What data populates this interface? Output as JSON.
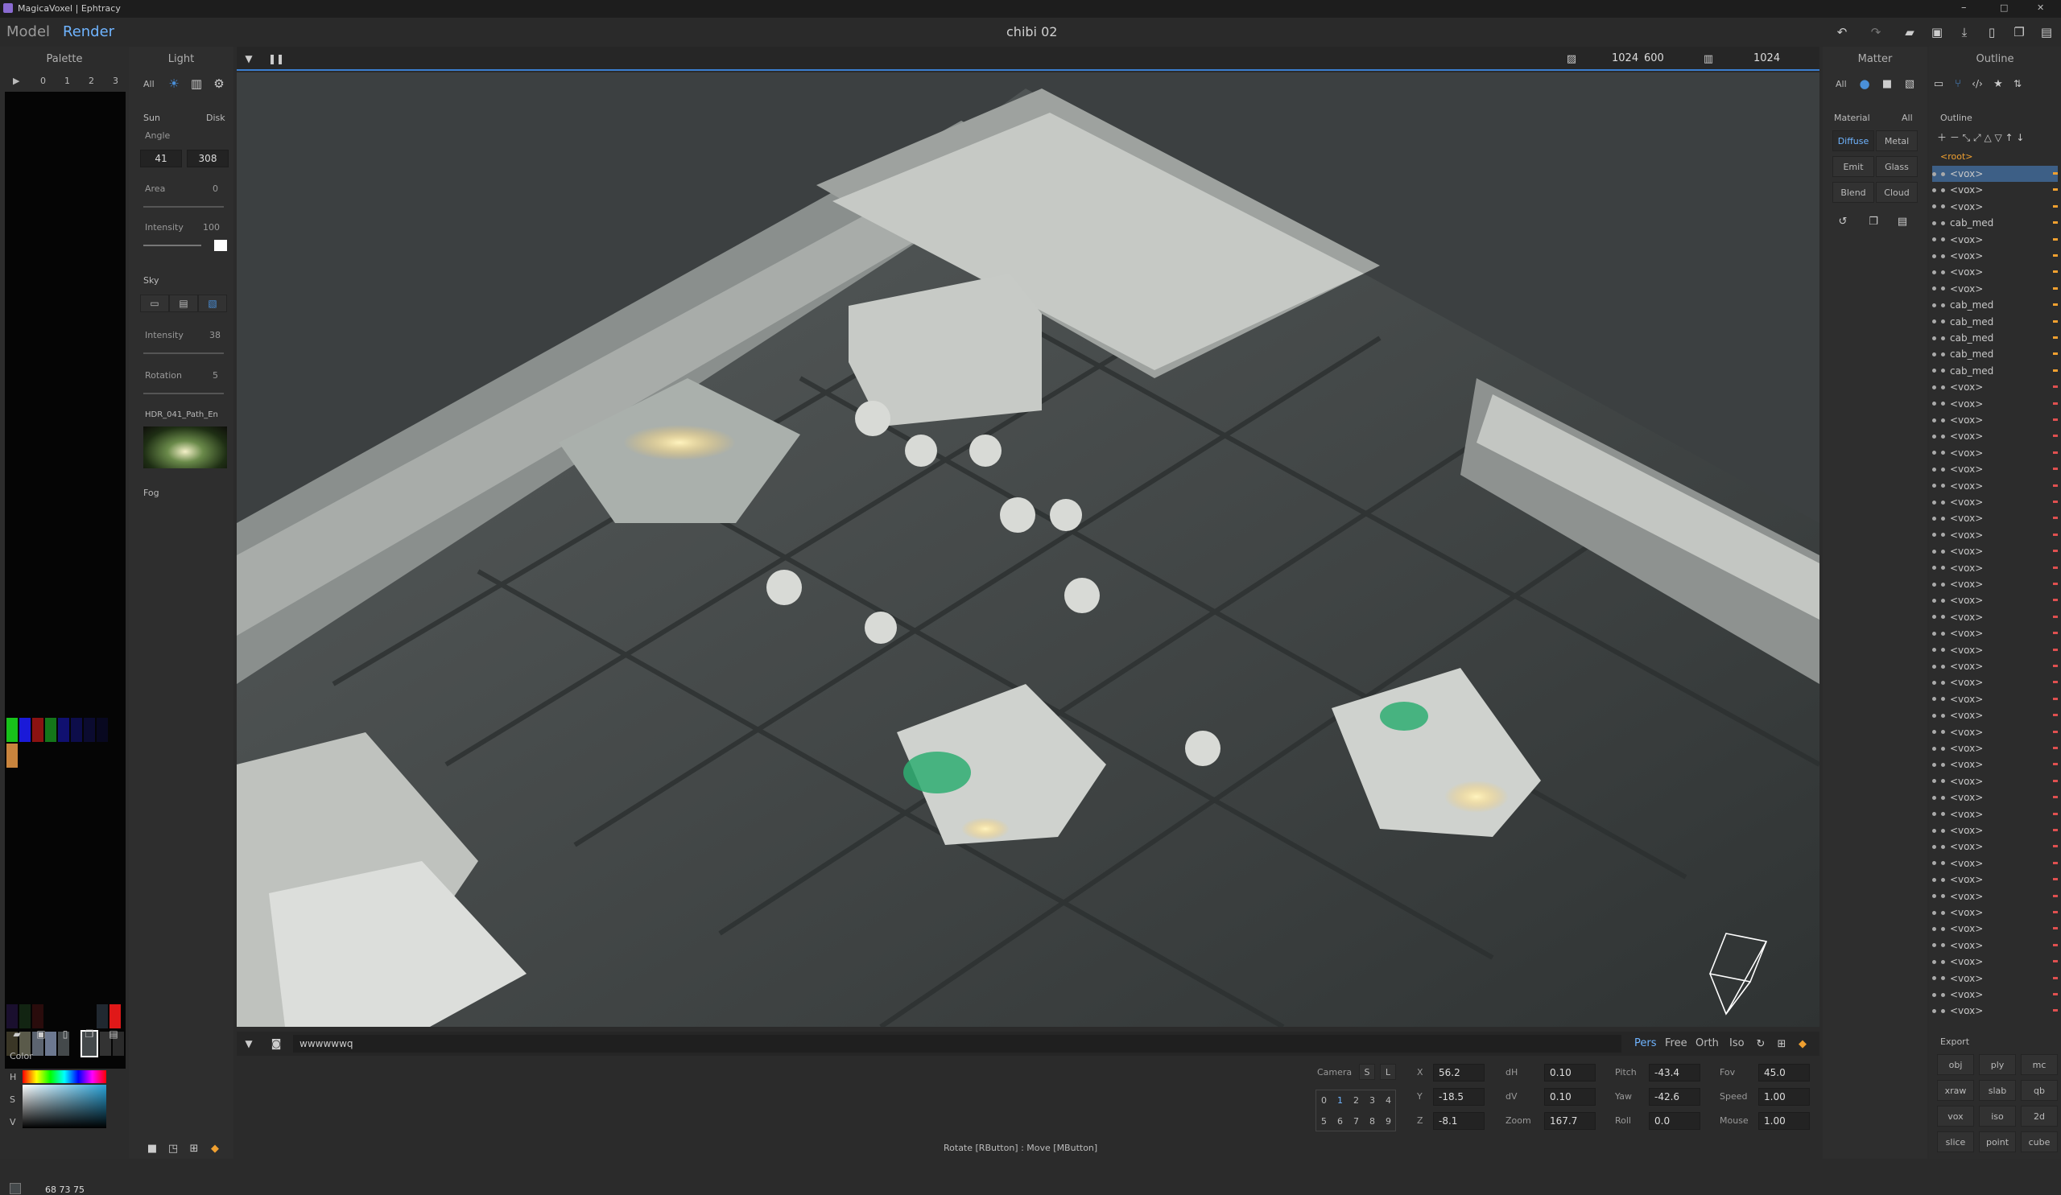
{
  "window": {
    "title": "MagicaVoxel | Ephtracy",
    "doc_title": "chibi 02",
    "min": "–",
    "max": "□",
    "close": "✕"
  },
  "modes": {
    "model": "Model",
    "render": "Render"
  },
  "palette": {
    "title": "Palette",
    "tabs": [
      "0",
      "1",
      "2",
      "3"
    ],
    "play": "▶"
  },
  "light": {
    "title": "Light",
    "filter_all": "All",
    "sun": {
      "label": "Sun",
      "mode": "Disk",
      "angle_label": "Angle",
      "angle_a": "41",
      "angle_b": "308",
      "area_label": "Area",
      "area_value": "0",
      "intensity_label": "Intensity",
      "intensity_value": "100"
    },
    "sky": {
      "label": "Sky",
      "intensity_label": "Intensity",
      "intensity_value": "38",
      "rotation_label": "Rotation",
      "rotation_value": "5",
      "hdr_name": "HDR_041_Path_En"
    },
    "fog": {
      "label": "Fog"
    }
  },
  "viewport": {
    "width": "1024",
    "height": "600",
    "samples": "1024",
    "status": "Rotate [RButton] : Move [MButton]",
    "command": "wwwwwwq",
    "proj": [
      "Pers",
      "Free",
      "Orth",
      "Iso"
    ],
    "camera": {
      "label": "Camera",
      "s": "S",
      "l": "L",
      "slots": [
        "0",
        "1",
        "2",
        "3",
        "4",
        "5",
        "6",
        "7",
        "8",
        "9"
      ],
      "x_label": "X",
      "x": "56.2",
      "y_label": "Y",
      "y": "-18.5",
      "z_label": "Z",
      "z": "-8.1",
      "dh_label": "dH",
      "dh": "0.10",
      "dv_label": "dV",
      "dv": "0.10",
      "zoom_label": "Zoom",
      "zoom": "167.7",
      "pitch_label": "Pitch",
      "pitch": "-43.4",
      "yaw_label": "Yaw",
      "yaw": "-42.6",
      "roll_label": "Roll",
      "roll": "0.0",
      "fov_label": "Fov",
      "fov": "45.0",
      "speed_label": "Speed",
      "speed": "1.00",
      "mouse_label": "Mouse",
      "mouse": "1.00"
    }
  },
  "matter": {
    "title": "Matter",
    "filter_all": "All",
    "material_label": "Material",
    "material_all": "All",
    "types": [
      "Diffuse",
      "Metal",
      "Emit",
      "Glass",
      "Blend",
      "Cloud"
    ]
  },
  "outline": {
    "title": "Outline",
    "section": "Outline",
    "root": "<root>",
    "items": [
      "<vox>",
      "<vox>",
      "<vox>",
      "cab_med",
      "<vox>",
      "<vox>",
      "<vox>",
      "<vox>",
      "cab_med",
      "cab_med",
      "cab_med",
      "cab_med",
      "cab_med",
      "<vox>",
      "<vox>",
      "<vox>",
      "<vox>",
      "<vox>",
      "<vox>",
      "<vox>",
      "<vox>",
      "<vox>",
      "<vox>",
      "<vox>",
      "<vox>",
      "<vox>",
      "<vox>",
      "<vox>",
      "<vox>",
      "<vox>",
      "<vox>",
      "<vox>",
      "<vox>",
      "<vox>",
      "<vox>",
      "<vox>",
      "<vox>",
      "<vox>",
      "<vox>",
      "<vox>",
      "<vox>",
      "<vox>",
      "<vox>",
      "<vox>",
      "<vox>",
      "<vox>",
      "<vox>",
      "<vox>",
      "<vox>",
      "<vox>",
      "<vox>",
      "<vox>"
    ]
  },
  "export": {
    "title": "Export",
    "formats": [
      "obj",
      "ply",
      "mc",
      "xraw",
      "slab",
      "qb",
      "vox",
      "iso",
      "2d",
      "slice",
      "point",
      "cube"
    ]
  },
  "color": {
    "label": "Color",
    "h": "H",
    "s": "S",
    "v": "V",
    "rgb": "68 73 75"
  },
  "colors": {
    "accent": "#4a90d9",
    "panel": "#2e2e2e",
    "bg": "#2b2b2b"
  }
}
